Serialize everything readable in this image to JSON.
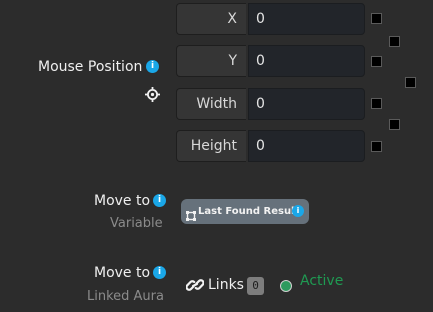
{
  "mouse_position": {
    "label": "Mouse Position",
    "info_icon": "info-icon",
    "target_icon": "crosshair-icon",
    "fields": [
      {
        "label": "X",
        "value": "0"
      },
      {
        "label": "Y",
        "value": "0"
      },
      {
        "label": "Width",
        "value": "0"
      },
      {
        "label": "Height",
        "value": "0"
      }
    ]
  },
  "move_to_variable": {
    "label": "Move to",
    "sublabel": "Variable",
    "info_icon": "info-icon",
    "chip": {
      "icon": "crop-icon",
      "text": "Last Found Result",
      "info_icon": "info-icon"
    }
  },
  "move_to_aura": {
    "label": "Move to",
    "sublabel": "Linked Aura",
    "info_icon": "info-icon",
    "links": {
      "icon": "link-icon",
      "label": "Links",
      "count": "0"
    },
    "status": {
      "label": "Active",
      "color": "#2e9a5e"
    }
  },
  "info_glyph": "i",
  "colors": {
    "background": "#2c2c2c",
    "info": "#1aa7e8",
    "active": "#1f9a52",
    "chip": "#66717b"
  }
}
